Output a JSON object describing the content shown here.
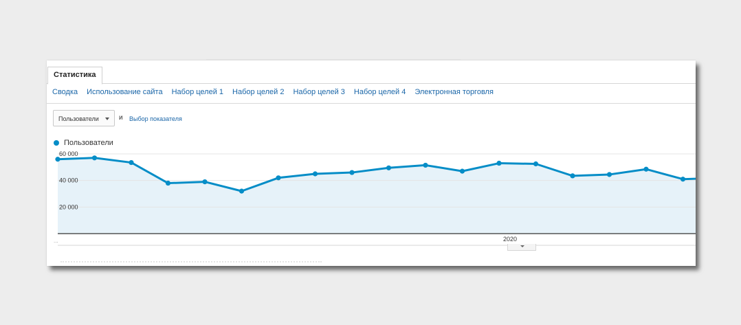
{
  "tabs": {
    "active_label": "Статистика"
  },
  "subnav": [
    {
      "label": "Сводка",
      "current": true
    },
    {
      "label": "Использование сайта",
      "current": false
    },
    {
      "label": "Набор целей 1",
      "current": false
    },
    {
      "label": "Набор целей 2",
      "current": false
    },
    {
      "label": "Набор целей 3",
      "current": false
    },
    {
      "label": "Набор целей 4",
      "current": false
    },
    {
      "label": "Электронная торговля",
      "current": false
    }
  ],
  "controls": {
    "metric_select_value": "Пользователи",
    "and_label": "и",
    "metric_link": "Выбор показателя"
  },
  "colors": {
    "series": "#058dc7",
    "area": "#e6f2f9",
    "link": "#1a66a8"
  },
  "chart_data": {
    "type": "area",
    "series": [
      {
        "name": "Пользователи",
        "values": [
          56000,
          57000,
          53500,
          38000,
          39000,
          32000,
          42000,
          45000,
          46000,
          49500,
          51500,
          47000,
          53000,
          52500,
          43500,
          44500,
          48500,
          41000,
          42000
        ]
      }
    ],
    "yticks": [
      {
        "value": 60000,
        "label": "60 000"
      },
      {
        "value": 40000,
        "label": "40 000"
      },
      {
        "value": 20000,
        "label": "20 000"
      }
    ],
    "ylim": [
      0,
      60000
    ],
    "xlabels": [
      {
        "index": 12.3,
        "label": "2020"
      }
    ],
    "xlabel_left": "...",
    "grid": true
  }
}
